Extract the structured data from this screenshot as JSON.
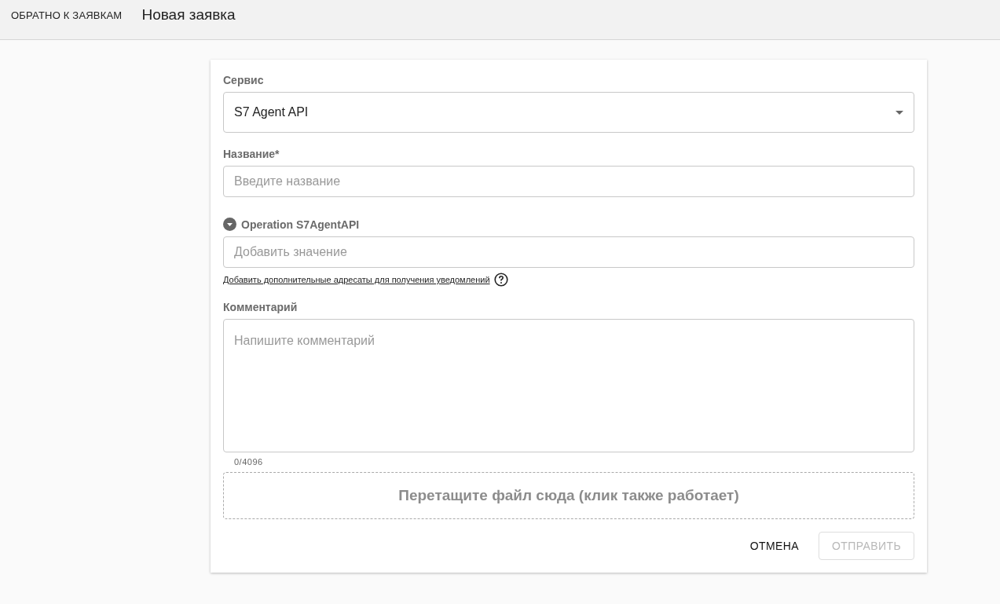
{
  "header": {
    "back_link": "ОБРАТНО К ЗАЯВКАМ",
    "title": "Новая заявка"
  },
  "form": {
    "service": {
      "label": "Сервис",
      "value": "S7 Agent API"
    },
    "name": {
      "label": "Название",
      "required_mark": "*",
      "placeholder": "Введите название"
    },
    "operation": {
      "label": "Operation S7AgentAPI",
      "placeholder": "Добавить значение",
      "help_link": "Добавить дополнительные адресаты для получения уведомлений"
    },
    "comment": {
      "label": "Комментарий",
      "placeholder": "Напишите комментарий",
      "counter": "0/4096"
    },
    "dropzone": {
      "text": "Перетащите файл сюда (клик также работает)"
    },
    "buttons": [
      {
        "label": "ОТМЕНА",
        "disabled": false
      },
      {
        "label": "ОТПРАВИТЬ",
        "disabled": true
      }
    ]
  }
}
